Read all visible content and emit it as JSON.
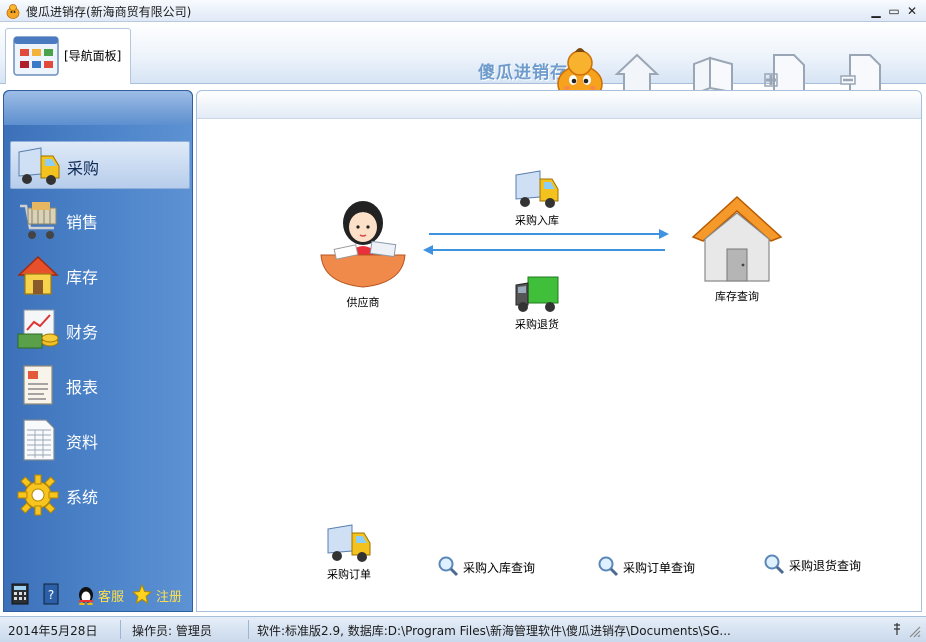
{
  "window": {
    "title": "傻瓜进销存(新海商贸有限公司)",
    "minimize_glyph": "▁",
    "maximize_glyph": "▭",
    "close_glyph": "✕"
  },
  "toolbar": {
    "nav_tab_label": "[导航面板]",
    "brand_text": "傻瓜进销存",
    "icons": [
      "home-icon",
      "cube-icon",
      "add-document-icon",
      "remove-document-icon"
    ]
  },
  "sidebar": {
    "items": [
      {
        "label": "采购",
        "icon": "truck-icon",
        "active": true
      },
      {
        "label": "销售",
        "icon": "shopping-cart-icon",
        "active": false
      },
      {
        "label": "库存",
        "icon": "house-icon",
        "active": false
      },
      {
        "label": "财务",
        "icon": "money-chart-icon",
        "active": false
      },
      {
        "label": "报表",
        "icon": "report-icon",
        "active": false
      },
      {
        "label": "资料",
        "icon": "spreadsheet-icon",
        "active": false
      },
      {
        "label": "系统",
        "icon": "gear-icon",
        "active": false
      }
    ],
    "bottom": {
      "service_label": "客服",
      "register_label": "注册"
    }
  },
  "flow": {
    "supplier_label": "供应商",
    "purchase_in_label": "采购入库",
    "purchase_return_label": "采购退货",
    "stock_query_label": "库存查询"
  },
  "quick_links": {
    "purchase_order_label": "采购订单",
    "purchase_in_query_label": "采购入库查询",
    "order_query_label": "采购订单查询",
    "return_query_label": "采购退货查询"
  },
  "status": {
    "date": "2014年5月28日",
    "operator": "操作员: 管理员",
    "software": "软件:标准版2.9, 数据库:D:\\Program Files\\新海管理软件\\傻瓜进销存\\Documents\\SG..."
  },
  "colors": {
    "sidebar_blue": "#4f86cb",
    "arrow_blue": "#3f92e0",
    "active_item": "#c8daf2"
  }
}
